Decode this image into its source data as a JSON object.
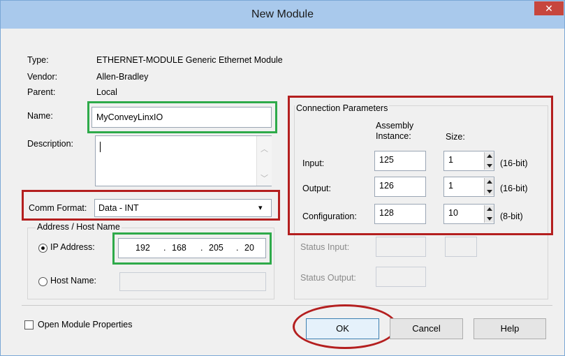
{
  "window": {
    "title": "New Module",
    "close_glyph": "✕"
  },
  "info": {
    "type_label": "Type:",
    "type_value": "ETHERNET-MODULE Generic Ethernet Module",
    "vendor_label": "Vendor:",
    "vendor_value": "Allen-Bradley",
    "parent_label": "Parent:",
    "parent_value": "Local"
  },
  "name": {
    "label": "Name:",
    "value": "MyConveyLinxIO"
  },
  "description": {
    "label": "Description:",
    "value": ""
  },
  "comm_format": {
    "label": "Comm Format:",
    "value": "Data - INT"
  },
  "address": {
    "group_label": "Address / Host Name",
    "ip_label": "IP Address:",
    "ip": [
      "192",
      "168",
      "205",
      "20"
    ],
    "host_label": "Host Name:",
    "selected": "ip"
  },
  "connection": {
    "group_label": "Connection Parameters",
    "assembly_header": "Assembly\nInstance:",
    "size_header": "Size:",
    "rows": [
      {
        "label": "Input:",
        "instance": "125",
        "size": "1",
        "unit": "(16-bit)"
      },
      {
        "label": "Output:",
        "instance": "126",
        "size": "1",
        "unit": "(16-bit)"
      },
      {
        "label": "Configuration:",
        "instance": "128",
        "size": "10",
        "unit": "(8-bit)"
      }
    ],
    "status_input_label": "Status Input:",
    "status_output_label": "Status Output:"
  },
  "footer": {
    "open_props_label": "Open Module Properties",
    "ok_label": "OK",
    "cancel_label": "Cancel",
    "help_label": "Help"
  },
  "colors": {
    "title_bar": "#a9c9ec",
    "highlight_red": "#b41f1f",
    "highlight_green": "#2eaa4a",
    "close_button": "#c7463d"
  }
}
